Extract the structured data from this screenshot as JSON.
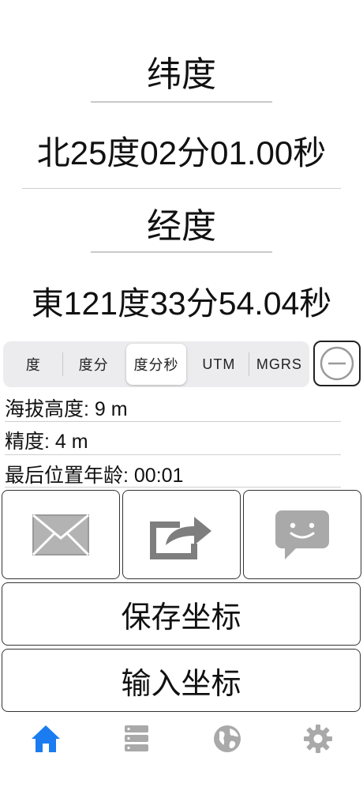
{
  "latitude": {
    "title": "纬度",
    "value": "北25度02分01.00秒"
  },
  "longitude": {
    "title": "经度",
    "value": "東121度33分54.04秒"
  },
  "format_options": [
    {
      "label": "度",
      "selected": false
    },
    {
      "label": "度分",
      "selected": false
    },
    {
      "label": "度分秒",
      "selected": true
    },
    {
      "label": "UTM",
      "selected": false
    },
    {
      "label": "MGRS",
      "selected": false
    }
  ],
  "info": {
    "altitude": "海拔高度: 9 m",
    "accuracy": "精度: 4 m",
    "last_age": "最后位置年龄: 00:01"
  },
  "actions": {
    "save_label": "保存坐标",
    "input_label": "输入坐标"
  },
  "icons": {
    "minus": "minus-circle-icon",
    "mail": "envelope-icon",
    "share": "share-icon",
    "message": "message-bubble-icon"
  },
  "tabs": [
    {
      "icon": "home-icon",
      "active": true
    },
    {
      "icon": "list-icon",
      "active": false
    },
    {
      "icon": "globe-icon",
      "active": false
    },
    {
      "icon": "gear-icon",
      "active": false
    }
  ],
  "colors": {
    "accent": "#1a7cf0",
    "inactive_icon": "#a9a9a9",
    "tile_icon": "#8a8a8a"
  }
}
